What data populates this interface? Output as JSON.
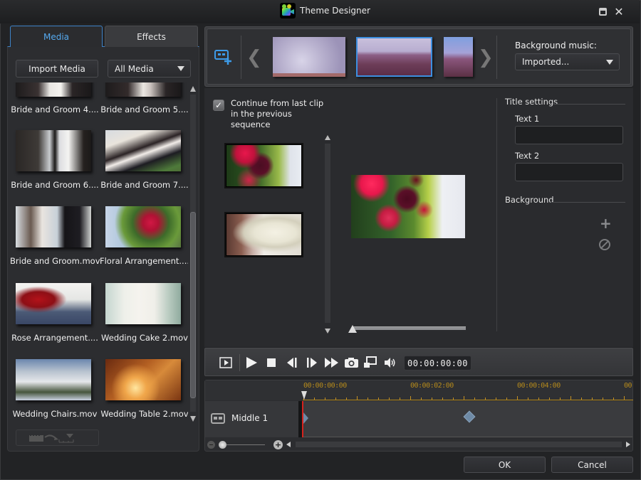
{
  "window": {
    "title": "Theme Designer",
    "app_icon": "video-camera-icon",
    "maximize_icon": "maximize-icon",
    "close_label": "✕"
  },
  "left_panel": {
    "tabs": [
      {
        "label": "Media",
        "active": true
      },
      {
        "label": "Effects",
        "active": false
      }
    ],
    "import_button": "Import Media",
    "filter_select": {
      "value": "All Media"
    },
    "media_items": [
      {
        "label": "Bride and Groom 4....",
        "thumb": "bride-groom-4"
      },
      {
        "label": "Bride and Groom 5....",
        "thumb": "bride-groom-5"
      },
      {
        "label": "Bride and Groom 6....",
        "thumb": "bride-groom-6"
      },
      {
        "label": "Bride and Groom 7....",
        "thumb": "bride-groom-7"
      },
      {
        "label": "Bride and Groom.mov",
        "thumb": "bride-groom"
      },
      {
        "label": "Floral Arrangement....",
        "thumb": "floral"
      },
      {
        "label": "Rose Arrangement....",
        "thumb": "rose"
      },
      {
        "label": "Wedding Cake 2.mov",
        "thumb": "cake"
      },
      {
        "label": "Wedding Chairs.mov",
        "thumb": "chairs"
      },
      {
        "label": "Wedding Table 2.mov",
        "thumb": "table"
      }
    ],
    "storyboard_button_icon": "insert-to-timeline-icon"
  },
  "template_strip": {
    "add_icon": "add-template-icon",
    "prev_label": "❮",
    "next_label": "❯",
    "templates": [
      {
        "name": "template-1",
        "selected": false
      },
      {
        "name": "template-2",
        "selected": true
      },
      {
        "name": "template-3",
        "selected": false
      }
    ],
    "background_music_label": "Background music:",
    "background_music_value": "Imported..."
  },
  "sequence": {
    "continue_checkbox": {
      "checked": true,
      "label": "Continue from last clip in the previous sequence"
    }
  },
  "title_settings": {
    "heading": "Title settings",
    "text1_label": "Text 1",
    "text1_value": "",
    "text2_label": "Text 2",
    "text2_value": "",
    "background_heading": "Background",
    "add_label": "+"
  },
  "transport": {
    "timecode": "00:00:00:00"
  },
  "timeline": {
    "ruler_labels": [
      "00:00:00:00",
      "00:00:02:00",
      "00:00:04:00",
      "00"
    ],
    "track_name": "Middle 1",
    "zoom_in_label": "+"
  },
  "footer": {
    "ok_label": "OK",
    "cancel_label": "Cancel"
  },
  "colors": {
    "accent": "#3d8fe0",
    "timecode_ruler": "#b58a1c",
    "playhead": "#d6231d",
    "keyframe": "#6e8aa6"
  }
}
